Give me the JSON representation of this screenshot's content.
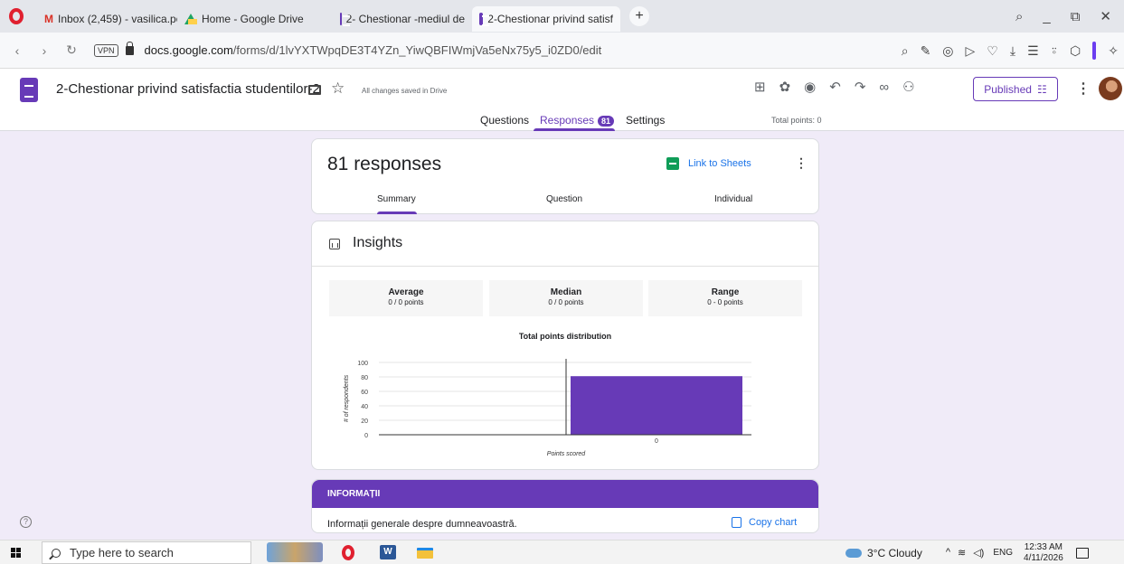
{
  "browser": {
    "tabs": [
      {
        "label": "Inbox (2,459) - vasilica.po|"
      },
      {
        "label": "Home - Google Drive"
      },
      {
        "label": "2- Chestionar -mediul de"
      },
      {
        "label": "2-Chestionar privind satisf"
      }
    ],
    "new_tab": "+",
    "window_controls": {
      "search": "⌕",
      "minimize": "_",
      "restore": "⧉",
      "close": "✕"
    },
    "vpn": "VPN",
    "url_domain": "docs.google.com",
    "url_path": "/forms/d/1lvYXTWpqDE3T4YZn_YiwQBFIWmjVa5eNx75y5_i0ZD0/edit"
  },
  "form": {
    "title": "2-Chestionar privind satisfactia studentilor-2",
    "saved_status": "All changes saved in Drive",
    "publish_label": "Published",
    "tabs": {
      "questions": "Questions",
      "responses": "Responses",
      "responses_count": "81",
      "settings": "Settings"
    },
    "total_points": "Total points: 0"
  },
  "summary": {
    "title": "81 responses",
    "link_sheets": "Link to Sheets",
    "subtabs": {
      "summary": "Summary",
      "question": "Question",
      "individual": "Individual"
    }
  },
  "insights": {
    "title": "Insights",
    "stats": [
      {
        "label": "Average",
        "value": "0 / 0 points"
      },
      {
        "label": "Median",
        "value": "0 / 0 points"
      },
      {
        "label": "Range",
        "value": "0 - 0 points"
      }
    ]
  },
  "chart_data": {
    "type": "bar",
    "title": "Total points distribution",
    "xlabel": "Points scored",
    "ylabel": "# of respondents",
    "categories": [
      "0"
    ],
    "values": [
      81
    ],
    "ylim": [
      0,
      100
    ],
    "yticks": [
      0,
      20,
      40,
      60,
      80,
      100
    ],
    "bar_color": "#673ab7",
    "grid": true
  },
  "section": {
    "title": "INFORMAȚII",
    "description": "Informații generale despre dumneavoastră.",
    "copy_chart": "Copy chart"
  },
  "taskbar": {
    "search_placeholder": "Type here to search",
    "word_icon": "W",
    "weather": "3°C  Cloudy",
    "language": "ENG",
    "time": "12:33 AM",
    "date": "4/11/2026"
  },
  "colors": {
    "accent": "#673ab7",
    "background": "#f0ebf8",
    "link": "#1a73e8"
  }
}
